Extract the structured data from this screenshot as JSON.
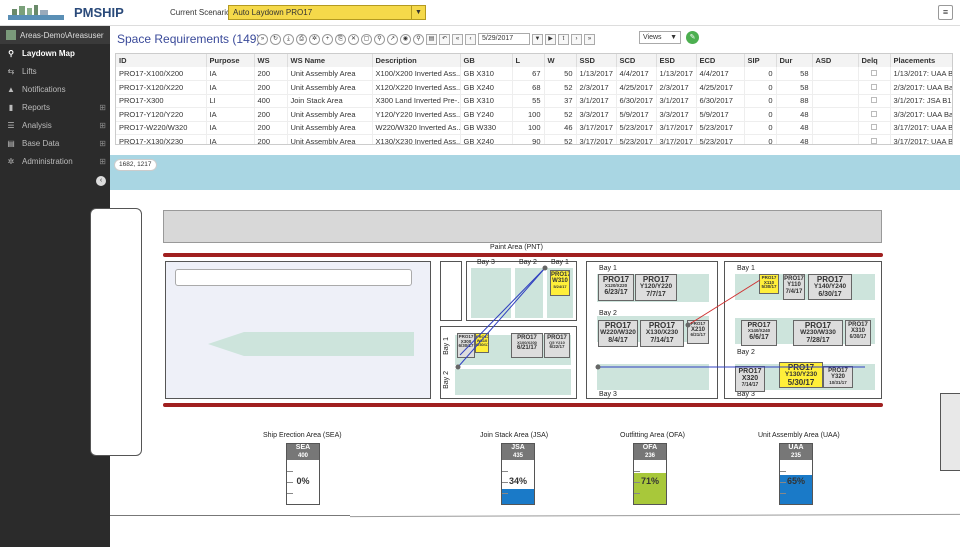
{
  "brand": "PMSHIP",
  "scenario": {
    "label": "Current Scenario:",
    "value": "Auto Laydown PRO17"
  },
  "user": "Areas-Demo\\Areasuser",
  "nav": [
    {
      "label": "Laydown Map",
      "icon": "pin-icon",
      "active": true
    },
    {
      "label": "Lifts",
      "icon": "lifts-icon"
    },
    {
      "label": "Notifications",
      "icon": "bell-icon"
    },
    {
      "label": "Reports",
      "icon": "reports-icon",
      "expandable": true
    },
    {
      "label": "Analysis",
      "icon": "analysis-icon",
      "expandable": true
    },
    {
      "label": "Base Data",
      "icon": "database-icon",
      "expandable": true
    },
    {
      "label": "Administration",
      "icon": "gear-icon",
      "expandable": true
    }
  ],
  "page": {
    "title": "Space Requirements (149)",
    "date": "5/29/2017",
    "views": "Views"
  },
  "grid": {
    "columns": [
      "ID",
      "Purpose",
      "WS",
      "WS Name",
      "Description",
      "GB",
      "L",
      "W",
      "SSD",
      "SCD",
      "ESD",
      "ECD",
      "SIP",
      "Dur",
      "ASD",
      "Delq",
      "Placements"
    ],
    "rows": [
      [
        "PRO17-X100/X200",
        "IA",
        "200",
        "Unit Assembly Area",
        "X100/X200 Inverted Ass...",
        "GB X310",
        "67",
        "50",
        "1/13/2017",
        "4/4/2017",
        "1/13/2017",
        "4/4/2017",
        "0",
        "58",
        "",
        "",
        "1/13/2017: UAA Bay 1"
      ],
      [
        "PRO17-X120/X220",
        "IA",
        "200",
        "Unit Assembly Area",
        "X120/X220 Inverted Ass...",
        "GB X240",
        "68",
        "52",
        "2/3/2017",
        "4/25/2017",
        "2/3/2017",
        "4/25/2017",
        "0",
        "58",
        "",
        "",
        "2/3/2017: UAA Bay 1"
      ],
      [
        "PRO17-X300",
        "LI",
        "400",
        "Join Stack Area",
        "X300 Land Inverted Pre-...",
        "GB X310",
        "55",
        "37",
        "3/1/2017",
        "6/30/2017",
        "3/1/2017",
        "6/30/2017",
        "0",
        "88",
        "",
        "",
        "3/1/2017: JSA B1"
      ],
      [
        "PRO17-Y120/Y220",
        "IA",
        "200",
        "Unit Assembly Area",
        "Y120/Y220 Inverted Ass...",
        "GB Y240",
        "100",
        "52",
        "3/3/2017",
        "5/9/2017",
        "3/3/2017",
        "5/9/2017",
        "0",
        "48",
        "",
        "",
        "3/3/2017: UAA Bay 2"
      ],
      [
        "PRO17-W220/W320",
        "IA",
        "200",
        "Unit Assembly Area",
        "W220/W320 Inverted As...",
        "GB W330",
        "100",
        "46",
        "3/17/2017",
        "5/23/2017",
        "3/17/2017",
        "5/23/2017",
        "0",
        "48",
        "",
        "",
        "3/17/2017: UAA Bay 2"
      ],
      [
        "PRO17-X130/X230",
        "IA",
        "200",
        "Unit Assembly Area",
        "X130/X230 Inverted Ass...",
        "GB X240",
        "90",
        "52",
        "3/17/2017",
        "5/23/2017",
        "3/17/2017",
        "5/23/2017",
        "0",
        "48",
        "",
        "",
        "3/17/2017: UAA Bay 2"
      ]
    ]
  },
  "map": {
    "coord": "1682, 1217",
    "paint_area": "Paint Area (PNT)",
    "bays": {
      "b3": "Bay 3",
      "b2": "Bay 2",
      "b1": "Bay 1",
      "b1v": "Bay 1",
      "b2v": "Bay 2"
    },
    "jsa_blocks": [
      {
        "t": "PRO17",
        "s": "W310",
        "d": "5/24/17",
        "yellow": true
      },
      {
        "t": "PRO17",
        "s": "X300",
        "d": "6/30/17"
      },
      {
        "t": "PRO17",
        "s": "W310",
        "d": "6/30/17",
        "yellow": true
      },
      {
        "t": "PRO17",
        "s": "X100/X200",
        "d": "6/21/17"
      },
      {
        "t": "PRO17",
        "s": "Q5 Y210",
        "d": "6/22/17"
      }
    ],
    "ofa": {
      "bay1": "Bay 1",
      "bay2": "Bay 2",
      "bay3": "Bay 3",
      "blocks": [
        {
          "t": "PRO17",
          "s": "X120/X220",
          "d": "6/23/17"
        },
        {
          "t": "PRO17",
          "s": "Y120/Y220",
          "d": "7/7/17"
        },
        {
          "t": "PRO17",
          "s": "W220/W320",
          "d": "8/4/17"
        },
        {
          "t": "PRO17",
          "s": "X130/X230",
          "d": "7/14/17"
        },
        {
          "t": "PRO17",
          "s": "X210",
          "d": "6/21/17"
        }
      ]
    },
    "uaa": {
      "bay1": "Bay 1",
      "bay2": "Bay 2",
      "bay3": "Bay 3",
      "blocks": [
        {
          "t": "PRO17",
          "s": "X110",
          "d": "5/30/17",
          "yellow": true
        },
        {
          "t": "PRO17",
          "s": "Y110",
          "d": "7/4/17"
        },
        {
          "t": "PRO17",
          "s": "Y140/Y240",
          "d": "6/30/17"
        },
        {
          "t": "PRO17",
          "s": "X140/X240",
          "d": "6/6/17"
        },
        {
          "t": "PRO17",
          "s": "W230/W330",
          "d": "7/28/17"
        },
        {
          "t": "PRO17",
          "s": "X310",
          "d": "6/30/17"
        },
        {
          "t": "PRO17",
          "s": "X320",
          "d": "7/14/17"
        },
        {
          "t": "PRO17",
          "s": "Y130/Y230",
          "d": "5/30/17",
          "yellow": true
        },
        {
          "t": "PRO17",
          "s": "Y320",
          "d": "10/31/17"
        }
      ]
    },
    "gauges": [
      {
        "title": "Ship Erection Area (SEA)",
        "code": "SEA",
        "num": "400",
        "pct": "0%",
        "value": 0,
        "color": "#1a7ac8"
      },
      {
        "title": "Join Stack Area (JSA)",
        "code": "JSA",
        "num": "435",
        "pct": "34%",
        "value": 0.34,
        "color": "#1a7ac8"
      },
      {
        "title": "Outfitting Area (OFA)",
        "code": "OFA",
        "num": "236",
        "pct": "71%",
        "value": 0.71,
        "color": "#a8c83a"
      },
      {
        "title": "Unit Assembly Area (UAA)",
        "code": "UAA",
        "num": "235",
        "pct": "65%",
        "value": 0.65,
        "color": "#1a7ac8"
      }
    ]
  }
}
